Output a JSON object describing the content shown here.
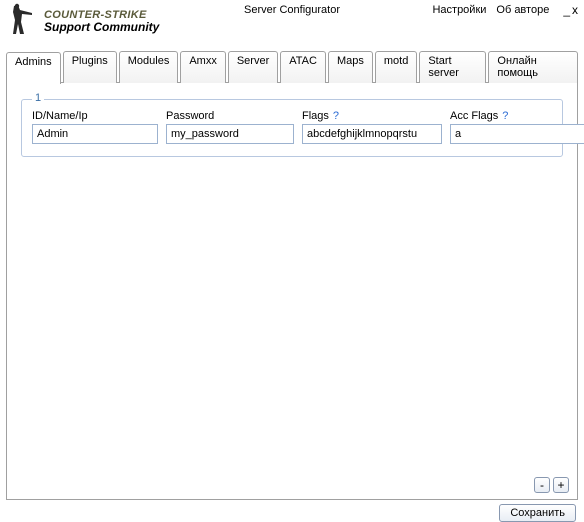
{
  "header": {
    "logo_line1": "COUNTER-STRIKE",
    "logo_line2": "Support Community",
    "title": "Server Configurator",
    "settings": "Настройки",
    "about": "Об авторе",
    "minimize": "_",
    "close": "x"
  },
  "tabs": {
    "items": [
      {
        "label": "Admins"
      },
      {
        "label": "Plugins"
      },
      {
        "label": "Modules"
      },
      {
        "label": "Amxx"
      },
      {
        "label": "Server"
      },
      {
        "label": "ATAC"
      },
      {
        "label": "Maps"
      },
      {
        "label": "motd"
      },
      {
        "label": "Start server"
      },
      {
        "label": "Онлайн помощь"
      }
    ],
    "active_index": 0
  },
  "group": {
    "legend": "1",
    "labels": {
      "id": "ID/Name/Ip",
      "password": "Password",
      "flags": "Flags",
      "accflags": "Acc Flags",
      "help": "?"
    },
    "values": {
      "id": "Admin",
      "password": "my_password",
      "flags": "abcdefghijklmnopqrstu",
      "accflags": "a"
    }
  },
  "buttons": {
    "minus": "-",
    "plus": "+",
    "save": "Сохранить"
  }
}
